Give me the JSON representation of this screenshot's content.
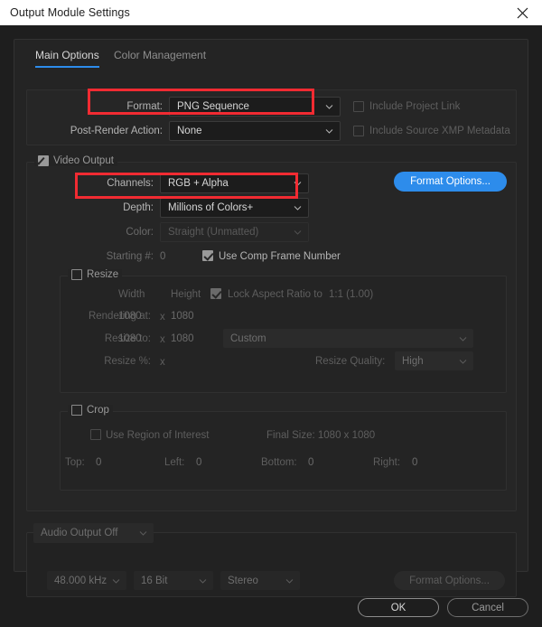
{
  "window": {
    "title": "Output Module Settings",
    "close_icon": "close-icon"
  },
  "tabs": [
    {
      "label": "Main Options",
      "active": true
    },
    {
      "label": "Color Management",
      "active": false
    }
  ],
  "format_group": {
    "format_label": "Format:",
    "format_value": "PNG Sequence",
    "post_render_label": "Post-Render Action:",
    "post_render_value": "None",
    "include_project_link": {
      "label": "Include Project Link",
      "checked": false,
      "enabled": false
    },
    "include_xmp": {
      "label": "Include Source XMP Metadata",
      "checked": false,
      "enabled": false
    }
  },
  "video_output": {
    "legend": "Video Output",
    "checked": true,
    "channels_label": "Channels:",
    "channels_value": "RGB + Alpha",
    "depth_label": "Depth:",
    "depth_value": "Millions of Colors+",
    "color_label": "Color:",
    "color_value": "Straight (Unmatted)",
    "starting_label": "Starting #:",
    "starting_value": "0",
    "use_comp_frame_number": {
      "label": "Use Comp Frame Number",
      "checked": true
    },
    "format_options_button": "Format Options..."
  },
  "resize": {
    "legend": "Resize",
    "checked": false,
    "width_header": "Width",
    "height_header": "Height",
    "lock_aspect": {
      "label": "Lock Aspect Ratio to",
      "value": "1:1 (1.00)",
      "checked": true
    },
    "rendering_at_label": "Rendering at:",
    "rendering_at_width": "1080",
    "rendering_at_height": "1080",
    "resize_to_label": "Resize to:",
    "resize_to_width": "1080",
    "resize_to_height": "1080",
    "preset_value": "Custom",
    "resize_pct_label": "Resize %:",
    "times_symbol": "x",
    "resize_quality_label": "Resize Quality:",
    "resize_quality_value": "High"
  },
  "crop": {
    "legend": "Crop",
    "checked": false,
    "use_region_of_interest": {
      "label": "Use Region of Interest",
      "checked": false
    },
    "final_size": "Final Size: 1080 x 1080",
    "top_label": "Top:",
    "top_value": "0",
    "left_label": "Left:",
    "left_value": "0",
    "bottom_label": "Bottom:",
    "bottom_value": "0",
    "right_label": "Right:",
    "right_value": "0"
  },
  "audio": {
    "mode_value": "Audio Output Off",
    "sample_rate": "48.000 kHz",
    "bit_depth": "16 Bit",
    "channels": "Stereo",
    "format_options_button": "Format Options..."
  },
  "footer": {
    "ok_label": "OK",
    "cancel_label": "Cancel"
  },
  "colors": {
    "accent_blue": "#2d8ceb",
    "highlight_red": "#f12b32",
    "titlebar_bg": "#ffffff",
    "dialog_bg": "#1e1e1e"
  }
}
